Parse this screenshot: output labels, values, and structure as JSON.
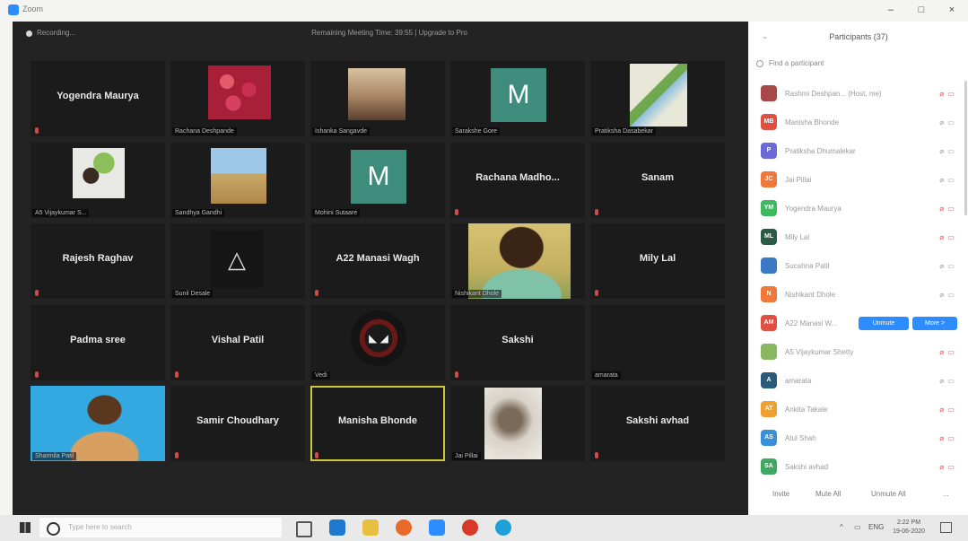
{
  "window": {
    "title": "Zoom",
    "controls": {
      "minimize": "–",
      "restore": "□",
      "close": "×"
    }
  },
  "meeting": {
    "recording_label": "Recording...",
    "notice": "Remaining Meeting Time: 39:55 | Upgrade to Pro",
    "tiles": [
      {
        "name": "Yogendra Maurya",
        "label": "",
        "image": "none"
      },
      {
        "name": "",
        "label": "Rachana Deshpande",
        "image": "roses"
      },
      {
        "name": "",
        "label": "Ishanka Sangavde",
        "image": "people"
      },
      {
        "name": "",
        "label": "Sarakshe Gore",
        "image": "letter",
        "letter": "M"
      },
      {
        "name": "",
        "label": "Pratiksha Dasabekar",
        "image": "card"
      },
      {
        "name": "",
        "label": "A5 Vijaykumar S...",
        "image": "girl"
      },
      {
        "name": "",
        "label": "Sandhya Gandhi",
        "image": "field"
      },
      {
        "name": "",
        "label": "Mohini Sutaare",
        "image": "letter",
        "letter": "M"
      },
      {
        "name": "Rachana Madho...",
        "label": "",
        "image": "none"
      },
      {
        "name": "Sanam",
        "label": "",
        "image": "none"
      },
      {
        "name": "Rajesh Raghav",
        "label": "",
        "image": "none"
      },
      {
        "name": "",
        "label": "Sunil Desale",
        "image": "assassin",
        "symbol": "△"
      },
      {
        "name": "A22 Manasi Wagh",
        "label": "",
        "image": "none"
      },
      {
        "name": "",
        "label": "Nishikant Dhole",
        "image": "man"
      },
      {
        "name": "Mily Lal",
        "label": "",
        "image": "none"
      },
      {
        "name": "Padma sree",
        "label": "",
        "image": "none"
      },
      {
        "name": "Vishal Patil",
        "label": "",
        "image": "none"
      },
      {
        "name": "",
        "label": "Vedi",
        "image": "deadpool",
        "symbol": "◣ ◢"
      },
      {
        "name": "Sakshi",
        "label": "",
        "image": "none"
      },
      {
        "name": "",
        "label": "amarata",
        "image": "none"
      },
      {
        "name": "",
        "label": "Sharmila Patil",
        "image": "lady"
      },
      {
        "name": "Samir Choudhary",
        "label": "",
        "image": "none"
      },
      {
        "name": "Manisha Bhonde",
        "label": "",
        "image": "none",
        "active": true
      },
      {
        "name": "",
        "label": "Jai Pillai",
        "image": "blur"
      },
      {
        "name": "Sakshi avhad",
        "label": "",
        "image": "none"
      }
    ]
  },
  "participants_panel": {
    "title": "Participants (37)",
    "search_placeholder": "Find a participant",
    "participants": [
      {
        "initials": "",
        "name": "Rashmi Deshpan...  (Host, me)",
        "color": "#a84848",
        "muted": true
      },
      {
        "initials": "MB",
        "name": "Manisha Bhonde",
        "color": "#e05040",
        "muted": false
      },
      {
        "initials": "P",
        "name": "Pratiksha Dhumalekar",
        "color": "#6a6ad8",
        "muted": false
      },
      {
        "initials": "JC",
        "name": "Jai Pillai",
        "color": "#f07838",
        "muted": false
      },
      {
        "initials": "YM",
        "name": "Yogendra Maurya",
        "color": "#40b860",
        "muted": true
      },
      {
        "initials": "ML",
        "name": "Mily Lal",
        "color": "#2a5a48",
        "muted": true
      },
      {
        "initials": "",
        "name": "Sucahna Patil",
        "color": "#3a78c8",
        "muted": false
      },
      {
        "initials": "N",
        "name": "Nishikant Dhole",
        "color": "#f07838",
        "muted": false
      },
      {
        "initials": "AM",
        "name": "A22 Manasi W...",
        "color": "#e05040",
        "muted": false,
        "buttons": [
          "Unmute",
          "More >"
        ]
      },
      {
        "initials": "",
        "name": "A5 Vijaykumar Shetty",
        "color": "#8ab860",
        "muted": true
      },
      {
        "initials": "A",
        "name": "amarata",
        "color": "#2a5a78",
        "muted": false
      },
      {
        "initials": "AT",
        "name": "Ankita Takale",
        "color": "#f0a030",
        "muted": true
      },
      {
        "initials": "AS",
        "name": "Atul Shah",
        "color": "#3a90d8",
        "muted": true
      },
      {
        "initials": "SA",
        "name": "Sakshi avhad",
        "color": "#40a860",
        "muted": true
      }
    ],
    "footer": {
      "invite": "Invite",
      "mute_all": "Mute All",
      "unmute_all": "Unmute All",
      "more": "..."
    }
  },
  "taskbar": {
    "search_placeholder": "Type here to search",
    "clock_time": "2:22 PM",
    "clock_date": "19-06-2020",
    "tray_text": "ENG"
  }
}
